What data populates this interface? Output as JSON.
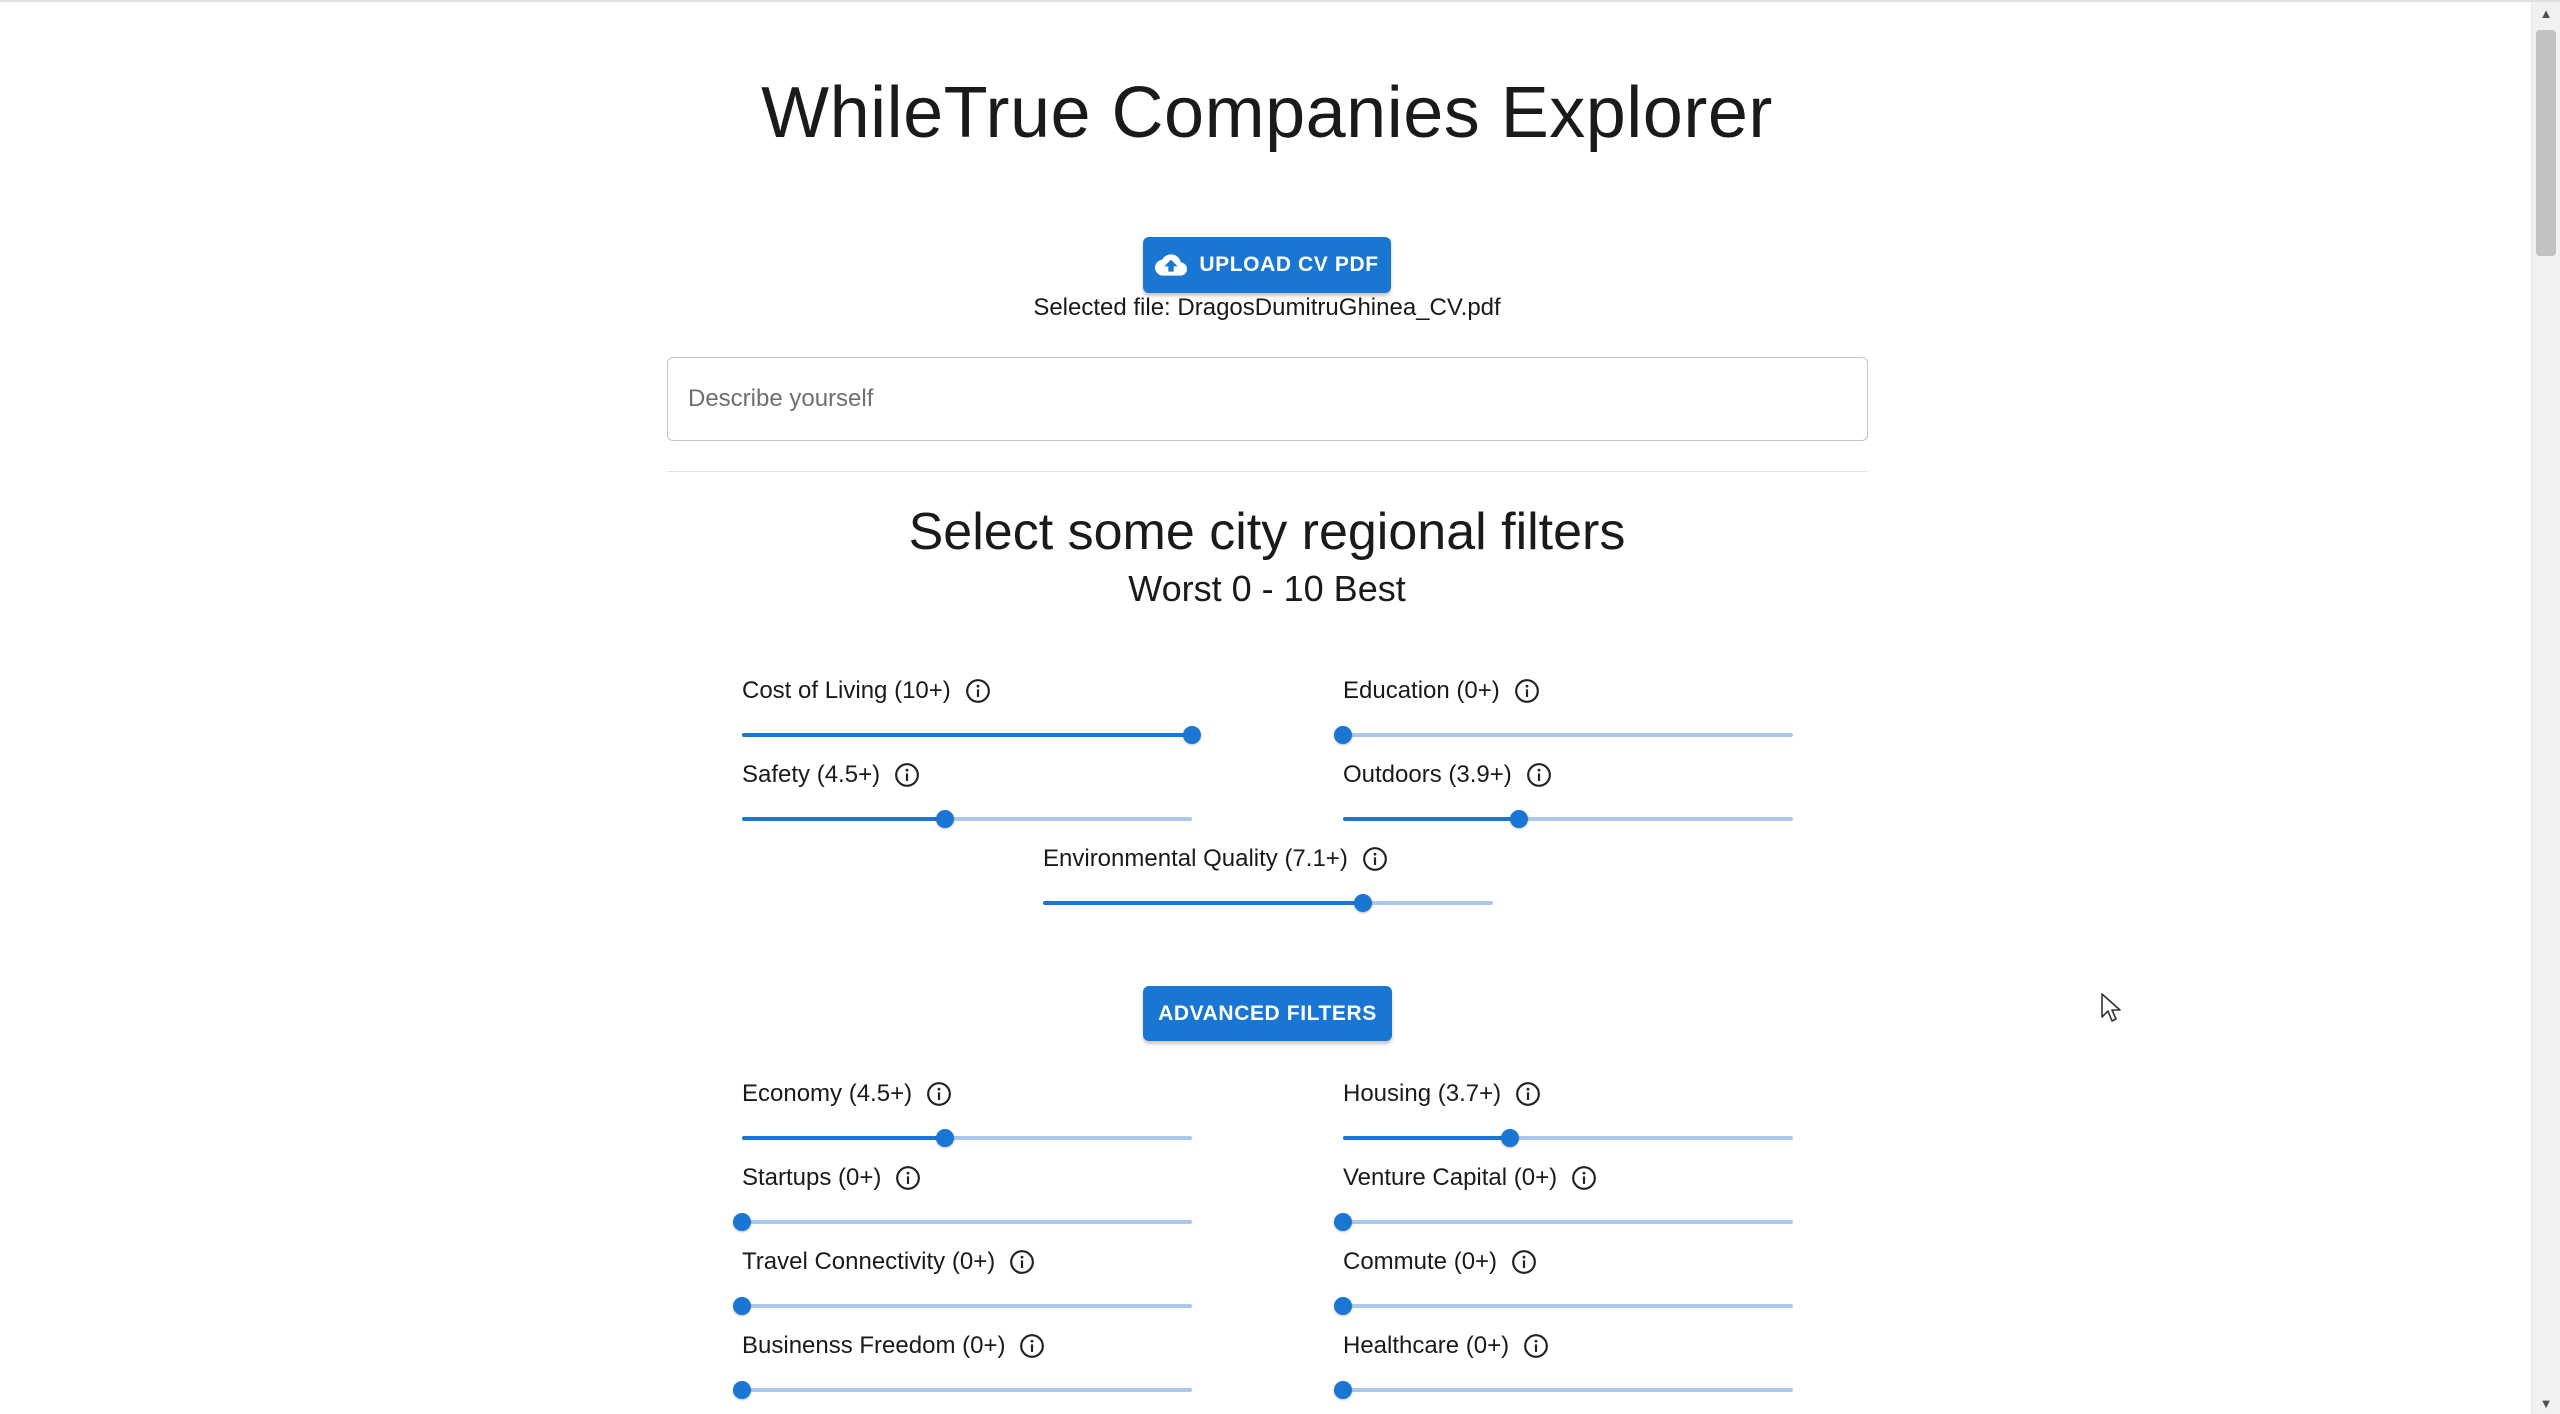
{
  "page": {
    "title": "WhileTrue Companies Explorer"
  },
  "upload": {
    "button_label": "UPLOAD CV PDF",
    "icon": "cloud-upload-icon",
    "selected_file_text": "Selected file: DragosDumitruGhinea_CV.pdf"
  },
  "describe": {
    "placeholder": "Describe yourself",
    "value": ""
  },
  "regional": {
    "title": "Select some city regional filters",
    "subtitle": "Worst 0 - 10 Best",
    "filters": [
      {
        "label": "Cost of Living (10+)",
        "value": 10,
        "max": 10
      },
      {
        "label": "Education (0+)",
        "value": 0,
        "max": 10
      },
      {
        "label": "Safety (4.5+)",
        "value": 4.5,
        "max": 10
      },
      {
        "label": "Outdoors (3.9+)",
        "value": 3.9,
        "max": 10
      },
      {
        "label": "Environmental Quality (7.1+)",
        "value": 7.1,
        "max": 10
      }
    ]
  },
  "advanced": {
    "button_label": "ADVANCED FILTERS",
    "filters": [
      {
        "label": "Economy (4.5+)",
        "value": 4.5,
        "max": 10
      },
      {
        "label": "Housing (3.7+)",
        "value": 3.7,
        "max": 10
      },
      {
        "label": "Startups (0+)",
        "value": 0,
        "max": 10
      },
      {
        "label": "Venture Capital (0+)",
        "value": 0,
        "max": 10
      },
      {
        "label": "Travel Connectivity (0+)",
        "value": 0,
        "max": 10
      },
      {
        "label": "Commute (0+)",
        "value": 0,
        "max": 10
      },
      {
        "label": "Businenss Freedom (0+)",
        "value": 0,
        "max": 10
      },
      {
        "label": "Healthcare (0+)",
        "value": 0,
        "max": 10
      }
    ]
  },
  "colors": {
    "primary": "#1976d2",
    "rail": "#a9c9ec"
  }
}
